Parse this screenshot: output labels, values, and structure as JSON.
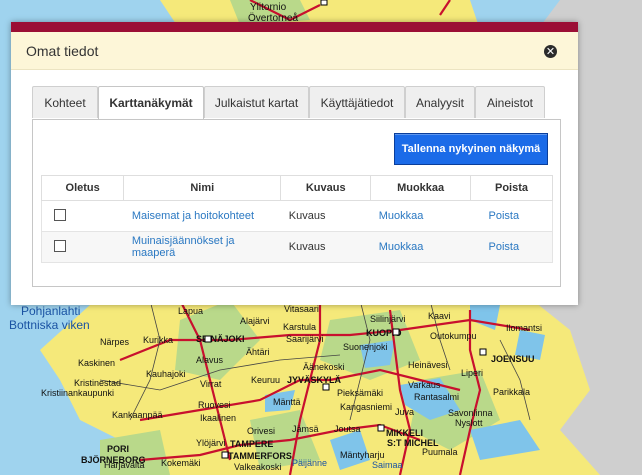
{
  "dialog": {
    "title": "Omat tiedot",
    "close_icon": "close-icon",
    "accent_color": "#9b0e35"
  },
  "tabs": [
    {
      "label": "Kohteet",
      "active": false
    },
    {
      "label": "Karttanäkymät",
      "active": true
    },
    {
      "label": "Julkaistut kartat",
      "active": false
    },
    {
      "label": "Käyttäjätiedot",
      "active": false
    },
    {
      "label": "Analyysit",
      "active": false
    },
    {
      "label": "Aineistot",
      "active": false
    }
  ],
  "panel": {
    "save_button_label": "Tallenna nykyinen näkymä",
    "table": {
      "headers": [
        "Oletus",
        "Nimi",
        "Kuvaus",
        "Muokkaa",
        "Poista"
      ],
      "rows": [
        {
          "default_checked": false,
          "name": "Maisemat ja hoitokohteet",
          "description": "Kuvaus",
          "edit": "Muokkaa",
          "delete": "Poista"
        },
        {
          "default_checked": false,
          "name": "Muinaisjäännökset ja maaperä",
          "description": "Kuvaus",
          "edit": "Muokkaa",
          "delete": "Poista"
        }
      ]
    }
  },
  "map": {
    "labels_top": [
      "Ylitornio",
      "Övertorneå"
    ],
    "labels_sea": [
      "Pohjanlahti",
      "Bottniska viken"
    ],
    "place_labels": [
      "Vitasaari",
      "Siilinjärvi",
      "Kaavi",
      "Lapua",
      "Alajärvi",
      "Karstula",
      "KUOPIO",
      "Outokumpu",
      "Ilomantsi",
      "Saarijärvi",
      "Suonenjoki",
      "Närpes",
      "Kurikka",
      "SEINÄJOKI",
      "Ähtäri",
      "Pieksämäki",
      "Äänekoski",
      "JOENSUU",
      "Kaskinen",
      "Kauhajoki",
      "Alavus",
      "Heinävesi",
      "Liperi",
      "Kristinestad",
      "Kristiinankaupunki",
      "Virrat",
      "Keuruu",
      "JYVÄSKYLÄ",
      "Varkaus",
      "Parikkala",
      "Kankaanpää",
      "Ruovesi",
      "Mänttä",
      "Rantasalmi",
      "Juva",
      "Savonlinna",
      "Ikaalinen",
      "Kangasniemi",
      "Nyslott",
      "Orivesi",
      "Jämsä",
      "Joutsa",
      "MIKKELI",
      "S:T MICHEL",
      "PORI",
      "Ylöjärvi",
      "BJÖRNEBORG",
      "TAMPERE",
      "TAMMERFORS",
      "Harjavalta",
      "Kokemäki",
      "Valkeakoski",
      "Päijänne",
      "Mäntyharju",
      "Saimaa",
      "Puumala"
    ],
    "land_color": "#f5e97a",
    "water_color": "#9fd3ee",
    "road_color": "#c8102e"
  }
}
